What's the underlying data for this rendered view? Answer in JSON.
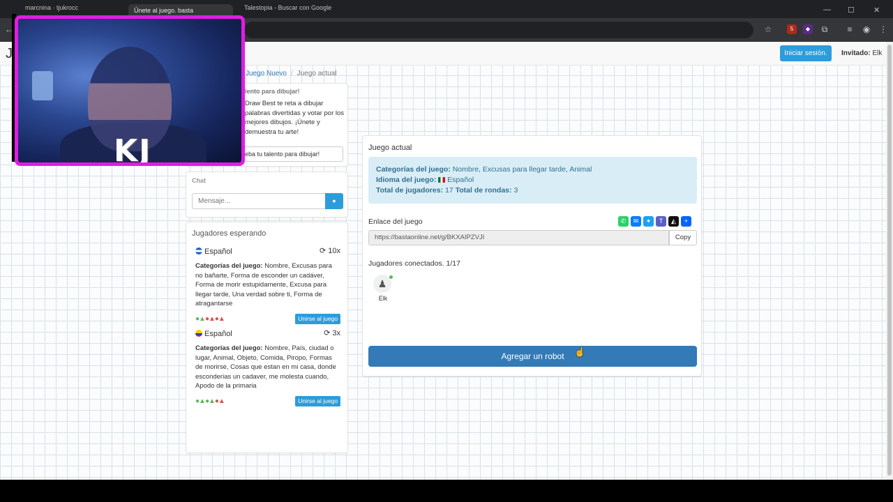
{
  "browser": {
    "tabs": [
      {
        "title": "marcnina · tjukrocc"
      },
      {
        "title": "Únete al juego. basta",
        "active": true
      },
      {
        "title": "Talestopia - Buscar con Google"
      }
    ],
    "ext_badge": "5"
  },
  "navbar": {
    "brand": "J",
    "login_label": "Iniciar sesión.",
    "guest_label": "Invitado:",
    "guest_name": "Elk"
  },
  "breadcrumb": {
    "new_game": "Juego Nuevo",
    "current": "Juego actual"
  },
  "promo": {
    "heading": "lento para dibujar!",
    "text": "Draw Best te reta a dibujar palabras divertidas y votar por los mejores dibujos. ¡Únete y demuestra tu arte!",
    "button": "eba tu talento para dibujar!"
  },
  "chat": {
    "title": "Chat",
    "placeholder": "Mensaje...",
    "send_icon": "comment-icon"
  },
  "waiting": {
    "title": "Jugadores esperando",
    "categories_label": "Categorías del juego:",
    "join_label": "Unirse al juego",
    "games": [
      {
        "language": "Español",
        "rounds": "10x",
        "categories": "Nombre, Excusas para no bañarte, Forma de esconder un cadáver, Forma de morir estupidamente, Excusa para llegar tarde, Una verdad sobre ti, Forma de atragantarse",
        "players_green": 1,
        "players_red": 2
      },
      {
        "language": "Español",
        "rounds": "3x",
        "categories": "Nombre, País, ciudad o lugar, Animal, Objeto, Comida, Piropo, Formas de morirse, Cosas que estan en mi casa, donde esconderias un cadaver, me molesta cuando, Apodo de la primaria",
        "players_green": 2,
        "players_red": 1
      }
    ]
  },
  "current_game": {
    "title": "Juego actual",
    "categories_label": "Categorías del juego:",
    "categories": "Nombre, Excusas para llegar tarde, Animal",
    "language_label": "Idioma del juego:",
    "language": "Español",
    "players_label": "Total de jugadores:",
    "players": "17",
    "rounds_label": "Total de rondas:",
    "rounds": "3",
    "link_label": "Enlace del juego",
    "link": "https://bastaonline.net/g/BKXAIPZVJI",
    "copy_label": "Copy",
    "connected_label": "Jugadores conectados. 1/17",
    "connected_player": "Elk",
    "add_robot": "Agregar un robot",
    "share_icons": [
      "whatsapp-icon",
      "messenger-icon",
      "twitter-icon",
      "teams-icon",
      "snapchat-icon",
      "share-more-icon"
    ]
  },
  "webcam": {
    "overlay_text": "KJ"
  },
  "colors": {
    "primary": "#337ab7",
    "accent": "#2d9cdb",
    "info_bg": "#d9edf7",
    "info_text": "#31708f",
    "webcam_border": "#e21ce2"
  }
}
